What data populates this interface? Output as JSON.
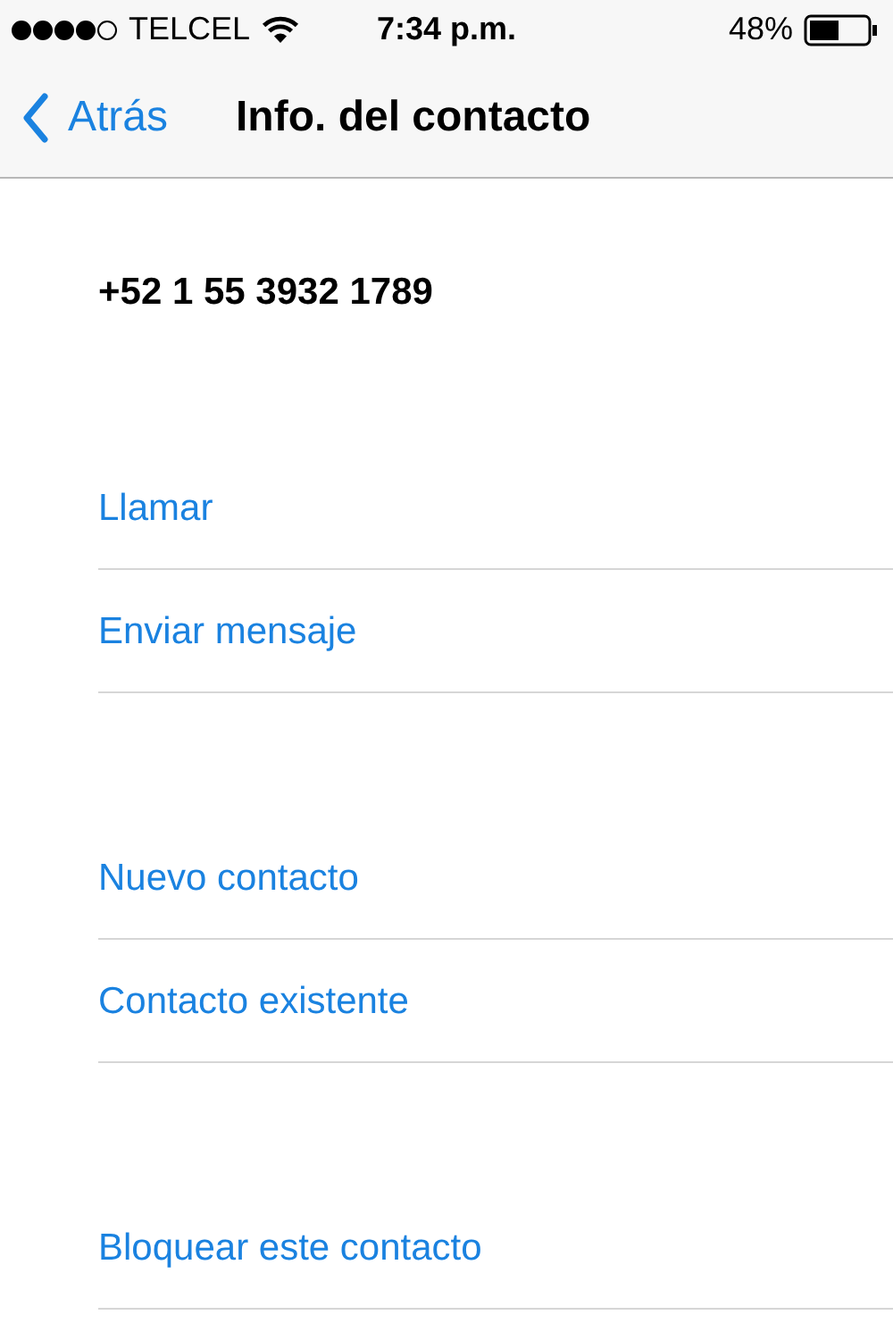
{
  "status_bar": {
    "carrier": "TELCEL",
    "time": "7:34 p.m.",
    "battery": "48%"
  },
  "nav_bar": {
    "back": "Atrás",
    "title": "Info. del contacto"
  },
  "phone_number": "+52 1 55 3932 1789",
  "sections": [
    {
      "items": [
        "Llamar",
        "Enviar mensaje"
      ]
    },
    {
      "items": [
        "Nuevo contacto",
        "Contacto existente"
      ]
    },
    {
      "items": [
        "Bloquear este contacto"
      ]
    }
  ]
}
